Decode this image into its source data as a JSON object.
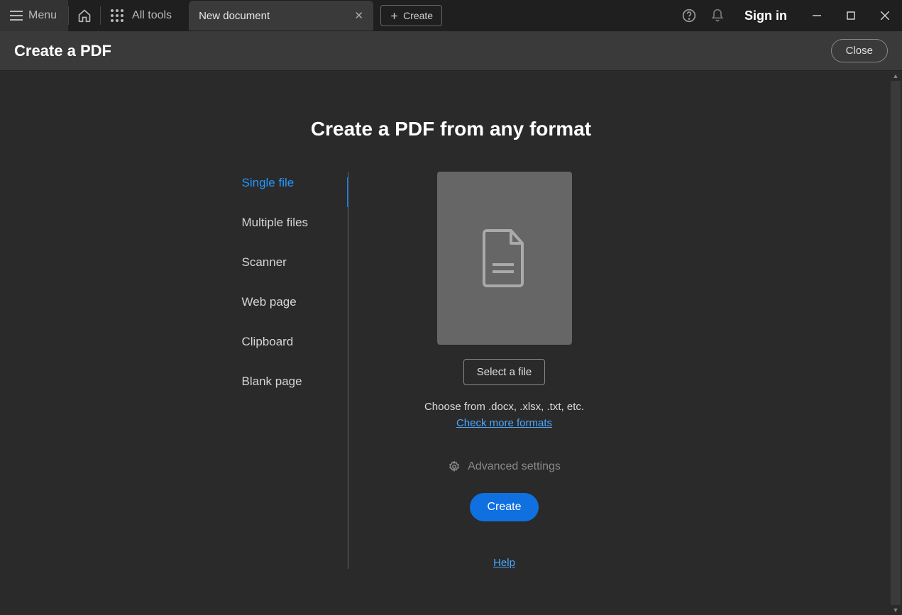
{
  "titlebar": {
    "menu_label": "Menu",
    "alltools_label": "All tools",
    "tab_label": "New document",
    "create_label": "Create",
    "signin_label": "Sign in"
  },
  "subheader": {
    "title": "Create a PDF",
    "close_label": "Close"
  },
  "main": {
    "heading": "Create a PDF from any format",
    "options": [
      "Single file",
      "Multiple files",
      "Scanner",
      "Web page",
      "Clipboard",
      "Blank page"
    ],
    "select_file_label": "Select a file",
    "hint_text": "Choose from .docx, .xlsx, .txt, etc.",
    "more_formats_label": "Check more formats",
    "advanced_label": "Advanced settings",
    "create_button_label": "Create",
    "help_label": "Help"
  }
}
